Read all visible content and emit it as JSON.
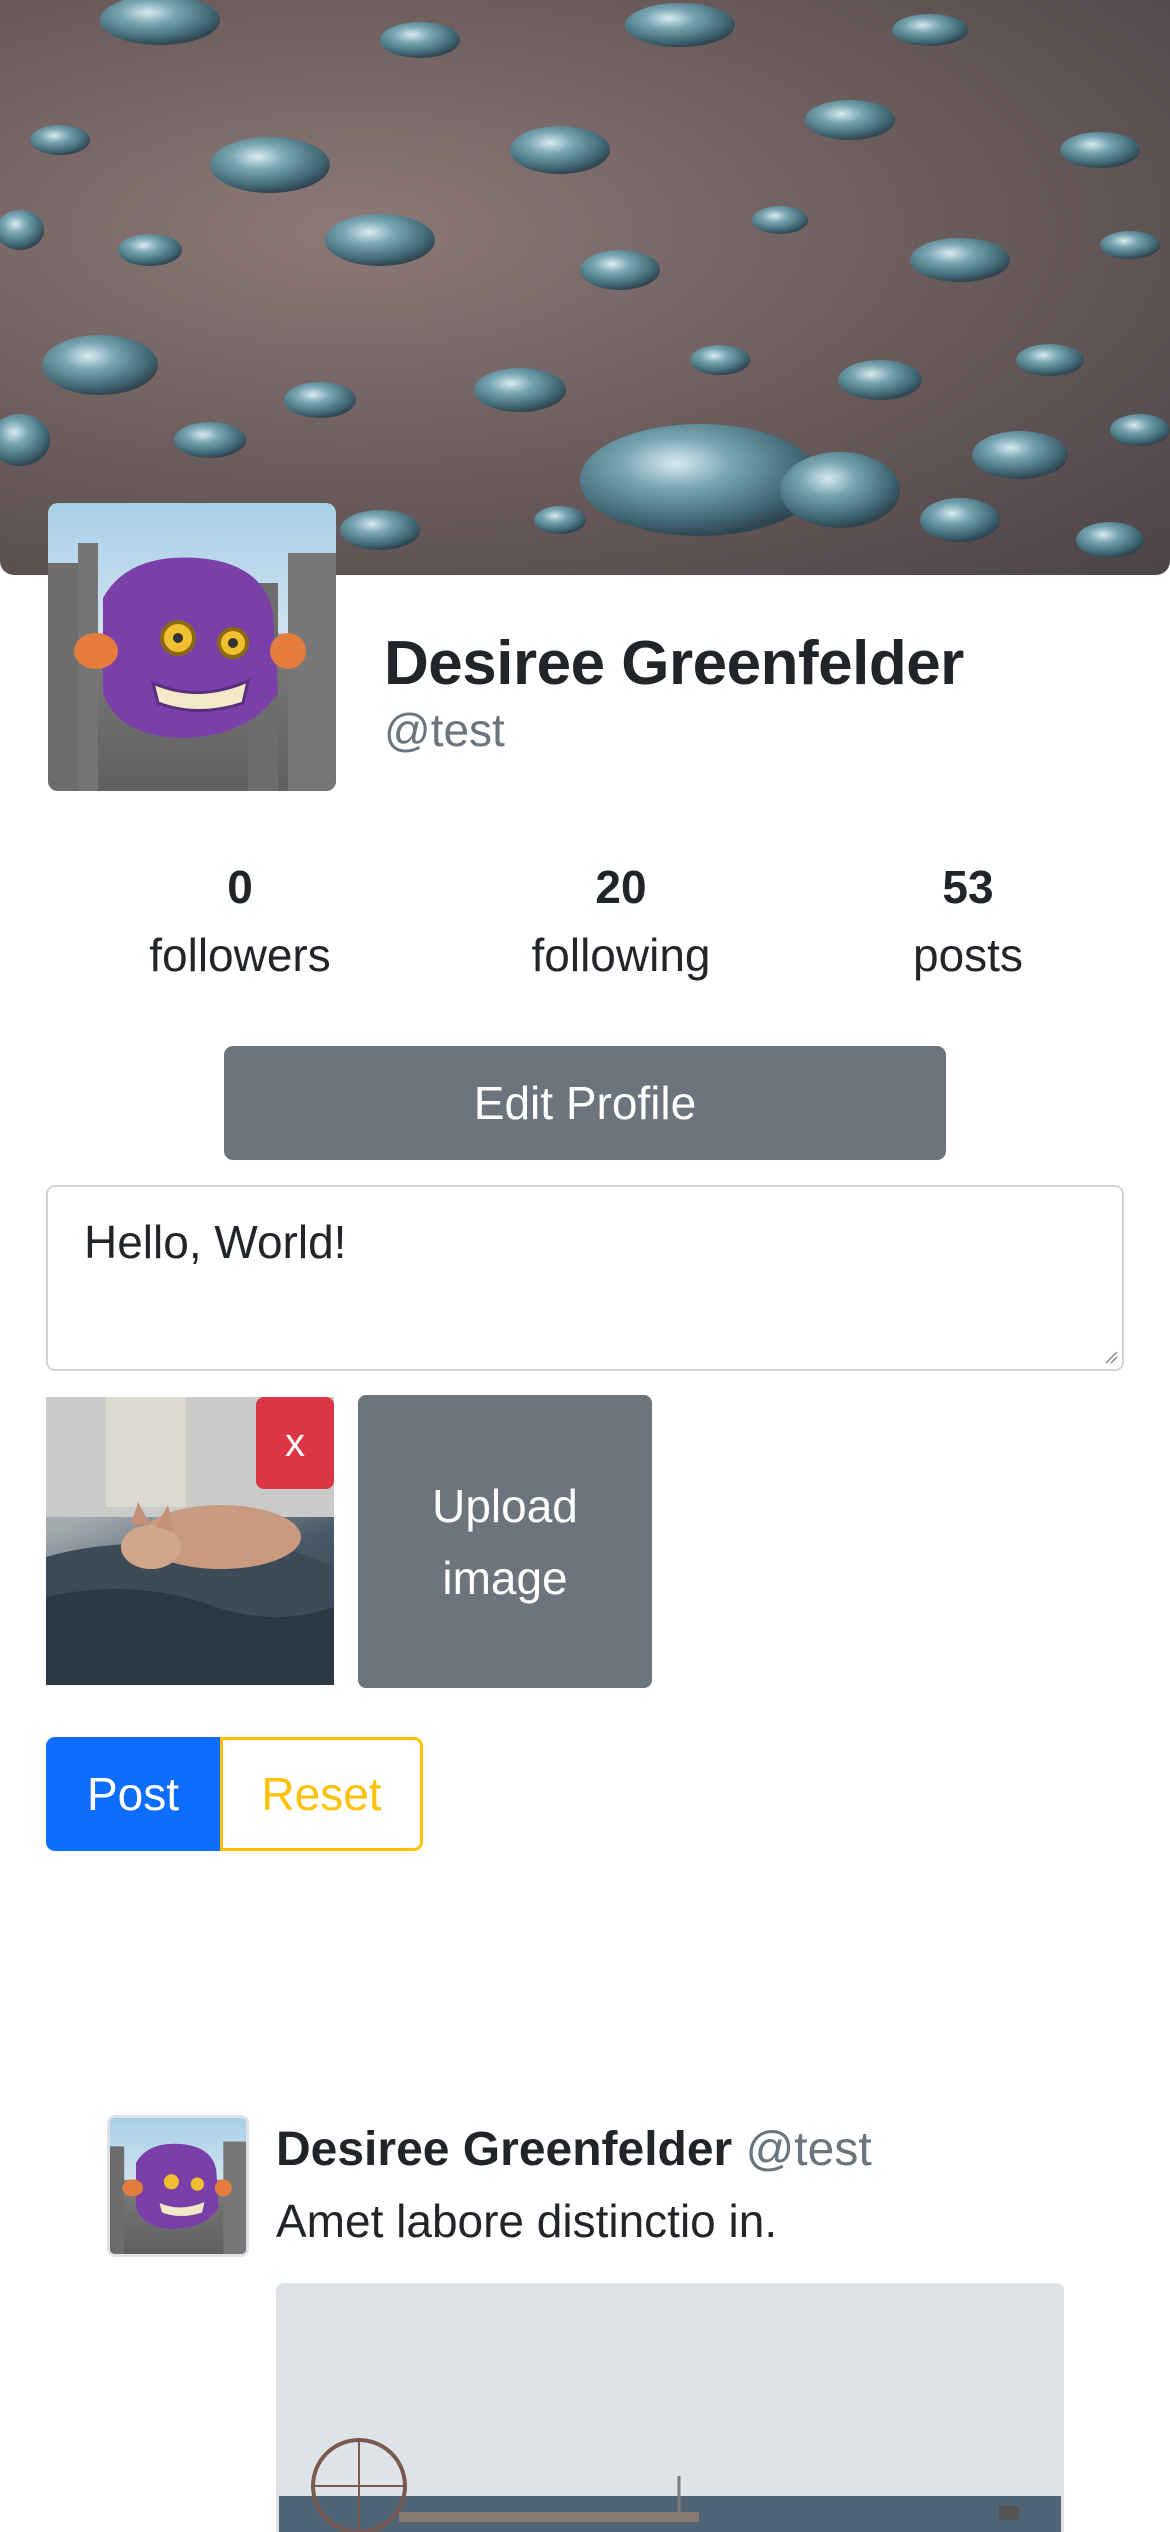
{
  "profile": {
    "name": "Desiree Greenfelder",
    "handle": "@test"
  },
  "stats": [
    {
      "value": "0",
      "label": "followers"
    },
    {
      "value": "20",
      "label": "following"
    },
    {
      "value": "53",
      "label": "posts"
    }
  ],
  "actions": {
    "edit_profile": "Edit Profile"
  },
  "composer": {
    "text": "Hello, World!",
    "remove_label": "x",
    "upload_label": "Upload image",
    "post_label": "Post",
    "reset_label": "Reset"
  },
  "feed": [
    {
      "author": "Desiree Greenfelder",
      "handle": "@test",
      "text": "Amet labore distinctio in."
    }
  ],
  "colors": {
    "primary": "#0d6efd",
    "secondary": "#6c757d",
    "danger": "#dc3545",
    "warning": "#ffc107"
  }
}
